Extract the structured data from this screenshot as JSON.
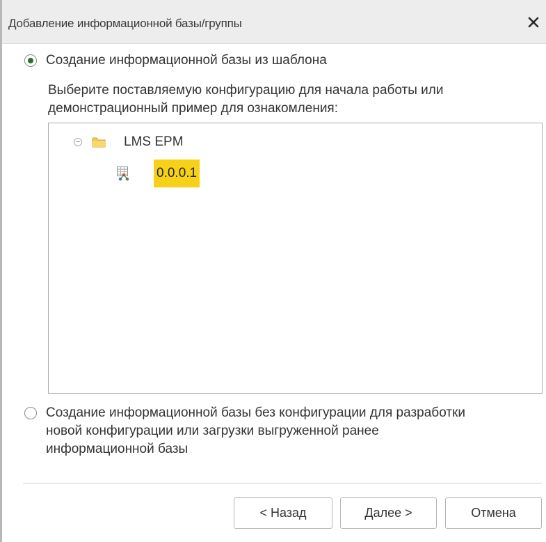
{
  "dialog": {
    "title": "Добавление информационной базы/группы"
  },
  "options": [
    {
      "label": "Создание информационной базы из шаблона",
      "checked": true
    },
    {
      "label_lines": [
        "Создание информационной базы без конфигурации для разработки",
        "новой конфигурации или загрузки выгруженной ранее",
        "информационной базы"
      ],
      "checked": false
    }
  ],
  "description_lines": [
    "Выберите поставляемую конфигурацию для начала работы или",
    "демонстрационный пример для ознакомления:"
  ],
  "tree": {
    "group": {
      "label": "LMS EPM",
      "icon": "folder-icon",
      "expanded": true
    },
    "item": {
      "label": "0.0.0.1",
      "icon": "configuration-icon",
      "selected": true
    }
  },
  "buttons": {
    "back": "< Назад",
    "next": "Далее >",
    "cancel": "Отмена"
  },
  "colors": {
    "selection": "#f7d117",
    "radio_dot": "#2b6f2b",
    "folder": "#f2c94c"
  }
}
